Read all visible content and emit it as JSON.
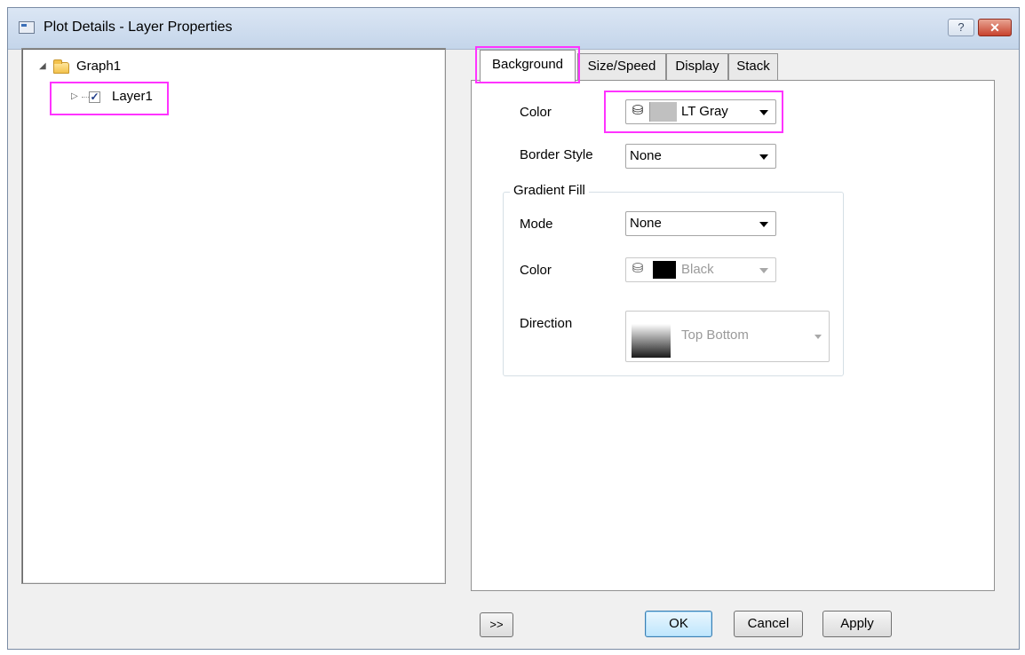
{
  "window": {
    "title": "Plot Details - Layer Properties",
    "help_label": "?",
    "close_label": "✕"
  },
  "tree": {
    "root": {
      "label": "Graph1",
      "expander": "◢"
    },
    "child": {
      "label": "Layer1",
      "expander": "▷",
      "checked": "✓"
    }
  },
  "tabs": [
    {
      "label": "Background"
    },
    {
      "label": "Size/Speed"
    },
    {
      "label": "Display"
    },
    {
      "label": "Stack"
    }
  ],
  "background": {
    "color_label": "Color",
    "color_value": "LT Gray",
    "border_style_label": "Border Style",
    "border_style_value": "None",
    "gradient_fill": {
      "title": "Gradient Fill",
      "mode_label": "Mode",
      "mode_value": "None",
      "color_label": "Color",
      "color_value": "Black",
      "direction_label": "Direction",
      "direction_value": "Top Bottom"
    }
  },
  "buttons": {
    "expand": ">>",
    "ok": "OK",
    "cancel": "Cancel",
    "apply": "Apply"
  },
  "colors": {
    "highlight": "#ff33ff",
    "lt_gray_swatch": "#c0c0c0",
    "black_swatch": "#000000"
  }
}
